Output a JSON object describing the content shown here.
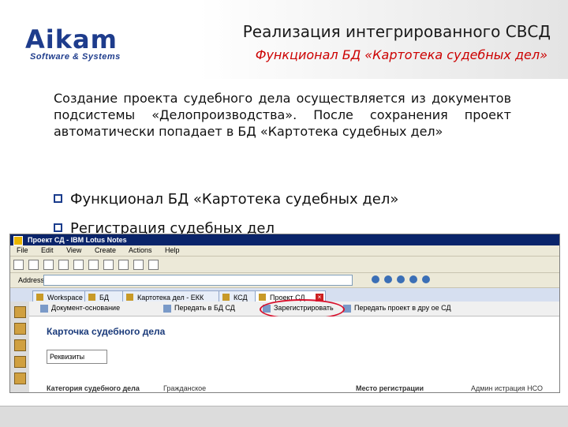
{
  "logo": {
    "main": "Aikam",
    "sub": "Software & Systems"
  },
  "slide": {
    "title": "Реализация интегрированного СВСД",
    "subtitle": "Функционал БД «Картотека судебных дел»",
    "paragraph": "Создание проекта судебного дела осуществляется из документов подсистемы «Делопроизводства». После сохранения проект автоматически попадает в БД «Картотека судебных дел»",
    "bullets": [
      "Функционал БД «Картотека судебных дел»",
      "Регистрация судебных дел"
    ]
  },
  "screenshot": {
    "window_title": "Проект СД - IBM Lotus Notes",
    "menu": [
      "File",
      "Edit",
      "View",
      "Create",
      "Actions",
      "Help"
    ],
    "address_label": "Address",
    "tabs": [
      "Workspace",
      "БД",
      "Картотека дел - ЕКК",
      "КСД",
      "Проект СД"
    ],
    "actions": [
      "Документ-основание",
      "Передать в БД СД",
      "Зарегистрировать",
      "Передать проект в дру ое СД"
    ],
    "form_title": "Карточка судебного дела",
    "field_label": "Реквизиты",
    "row_labels": [
      "Категория судебного дела",
      "Гражданское",
      "Место регистрации",
      "Админ истрация НСО"
    ]
  }
}
